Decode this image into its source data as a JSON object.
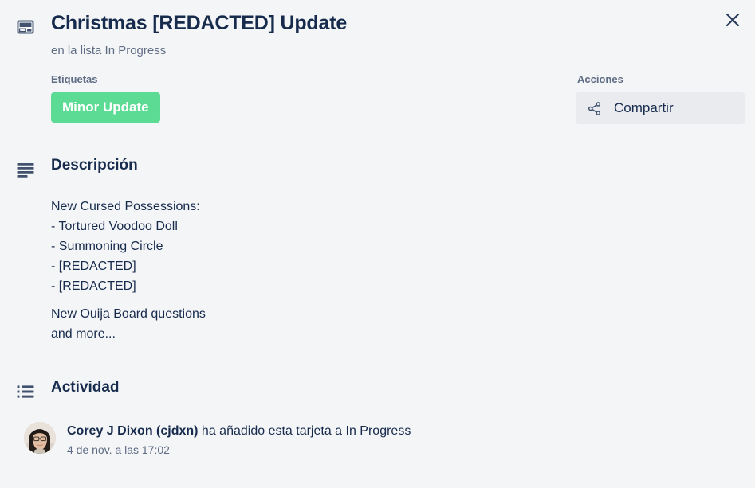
{
  "header": {
    "icon": "card-window-icon",
    "title": "Christmas [REDACTED] Update",
    "subtitle": "en la lista In Progress",
    "close_icon": "close-icon"
  },
  "labels": {
    "section_label": "Etiquetas",
    "items": [
      {
        "text": "Minor Update",
        "color": "#5bdb94"
      }
    ]
  },
  "actions": {
    "section_label": "Acciones",
    "items": [
      {
        "label": "Compartir",
        "icon": "share-icon"
      }
    ]
  },
  "description": {
    "icon": "description-lines-icon",
    "title": "Descripción",
    "paragraphs": [
      [
        "New Cursed Possessions:",
        "- Tortured Voodoo Doll",
        "- Summoning Circle",
        "- [REDACTED]",
        "- [REDACTED]"
      ],
      [
        "New Ouija Board questions",
        "and more..."
      ]
    ]
  },
  "activity": {
    "icon": "activity-list-icon",
    "title": "Actividad",
    "entries": [
      {
        "avatar": "user-avatar-photo",
        "member": "Corey J Dixon (cjdxn)",
        "action": " ha añadido esta tarjeta a In Progress",
        "timestamp": "4 de nov. a las 17:02"
      }
    ]
  },
  "theme": {
    "background": "#f4f5f7",
    "text_primary": "#172b4d",
    "text_muted": "#5e6c84",
    "button_background": "#e9ebee",
    "label_green": "#5bdb94"
  }
}
